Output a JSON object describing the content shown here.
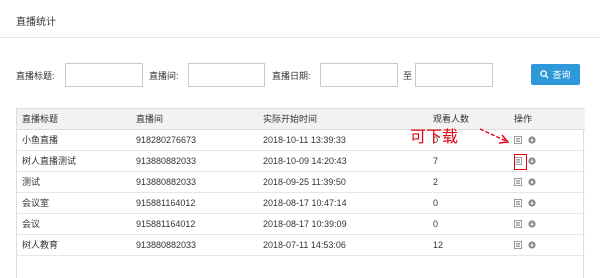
{
  "page": {
    "title": "直播统计"
  },
  "filters": {
    "title_label": "直播标题:",
    "title_value": "",
    "room_label": "直播间:",
    "room_value": "",
    "date_label": "直播日期:",
    "date_from": "",
    "date_sep": "至",
    "date_to": ""
  },
  "search_button": {
    "label": "查询",
    "icon": "search-icon"
  },
  "table": {
    "headers": [
      "直播标题",
      "直播间",
      "实际开始时间",
      "观看人数",
      "操作"
    ],
    "rows": [
      {
        "title": "小鱼直播",
        "room": "918280276673",
        "start": "2018-10-11 13:39:33",
        "viewers": "0"
      },
      {
        "title": "树人直播测试",
        "room": "913880882033",
        "start": "2018-10-09 14:20:43",
        "viewers": "7"
      },
      {
        "title": "测试",
        "room": "913880882033",
        "start": "2018-09-25 11:39:50",
        "viewers": "2"
      },
      {
        "title": "会议室",
        "room": "915881164012",
        "start": "2018-08-17 10:47:14",
        "viewers": "0"
      },
      {
        "title": "会议",
        "room": "915881164012",
        "start": "2018-08-17 10:39:09",
        "viewers": "0"
      },
      {
        "title": "树人教育",
        "room": "913880882033",
        "start": "2018-07-11 14:53:06",
        "viewers": "12"
      }
    ],
    "op_icons": [
      "detail-icon",
      "download-icon"
    ]
  },
  "annotation": {
    "text": "可下载",
    "color": "#e60012"
  },
  "colors": {
    "accent": "#2f98d8",
    "annotation": "#e60012"
  }
}
